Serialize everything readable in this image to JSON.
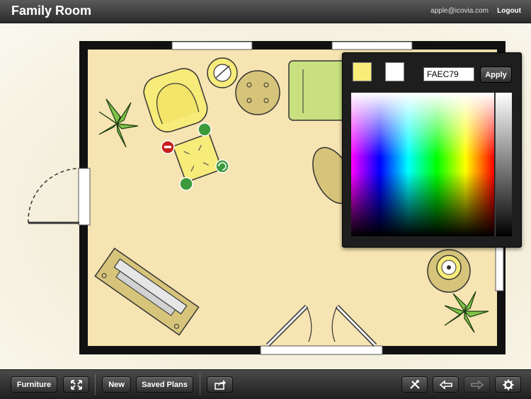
{
  "header": {
    "title": "Family Room",
    "user_email": "apple@icovia.com",
    "logout_label": "Logout"
  },
  "color_picker": {
    "hex_value": "FAEC79",
    "apply_label": "Apply",
    "current_color": "#FAEC79",
    "secondary_color": "#FFFFFF"
  },
  "toolbar": {
    "furniture_label": "Furniture",
    "new_label": "New",
    "saved_plans_label": "Saved Plans"
  },
  "colors": {
    "floor": "#F6E4B2",
    "wall": "#111111",
    "chair": "#F7EB7A",
    "sofa": "#C8E07F",
    "rug": "#D6C47A"
  }
}
